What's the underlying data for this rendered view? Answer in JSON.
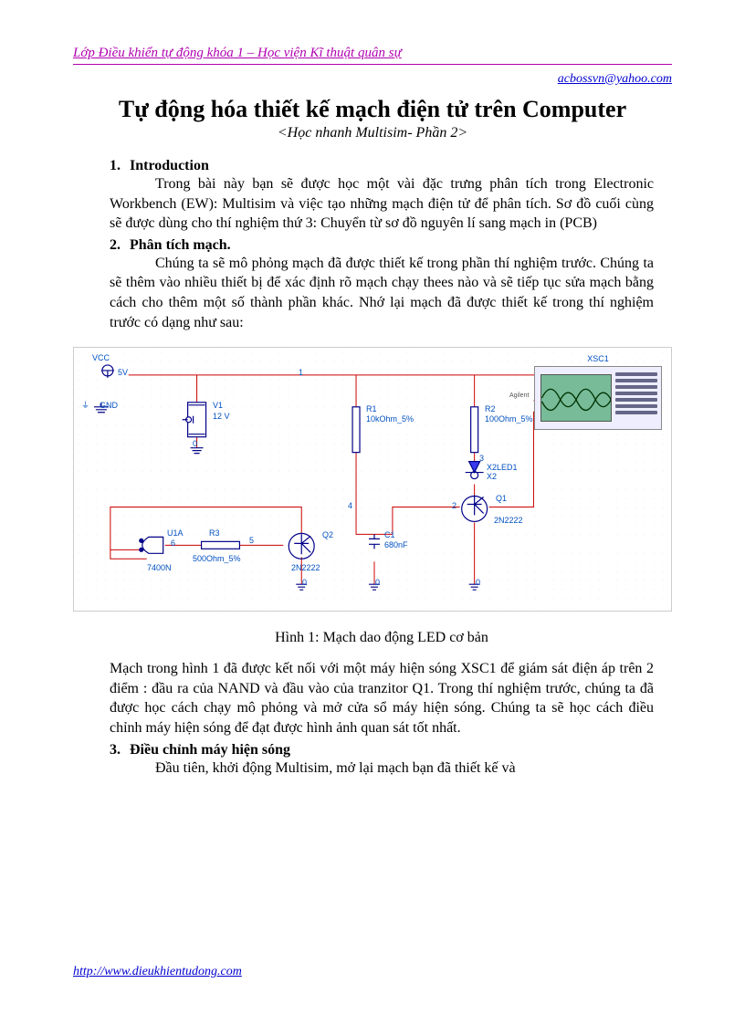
{
  "header": {
    "course": "Lớp Điều khiển tự động khóa 1 – Học viện Kĩ thuật quân sự",
    "email": "acbossvn@yahoo.com"
  },
  "title": "Tự động hóa thiết kế mạch điện tử trên Computer",
  "subtitle": "<Học nhanh Multisim- Phần 2>",
  "sections": {
    "s1": {
      "num": "1.",
      "head": "Introduction",
      "p1": "Trong bài này bạn sẽ được học một vài đặc trưng phân tích trong Electronic Workbench (EW): Multisim và việc tạo những mạch điện tử để phân tích. Sơ đồ cuối cùng sẽ được dùng cho thí nghiệm thứ 3: Chuyển từ sơ đồ nguyên lí sang mạch in (PCB)"
    },
    "s2": {
      "num": "2.",
      "head": "Phân tích mạch",
      "dot": ".",
      "p1": "Chúng ta sẽ mô phỏng mạch đã được thiết kế trong phần thí nghiệm trước. Chúng ta sẽ thêm vào nhiều thiết bị để xác định rõ mạch chạy thees nào và sẽ tiếp tục sửa mạch bằng cách cho thêm một số thành phần khác. Nhớ lại mạch đã được thiết kế trong thí nghiệm trước có dạng như sau:"
    },
    "caption": "Hình 1: Mạch dao động LED cơ bản",
    "p_after_fig": "Mạch trong hình 1 đã được kết nối với một máy hiện sóng XSC1 để giám sát điện áp trên 2 điểm : đầu ra của NAND và đầu vào của tranzitor Q1. Trong thí nghiệm trước, chúng ta đã được học cách chạy mô phỏng và  mở cửa sổ máy hiện sóng. Chúng ta sẽ học cách điều chỉnh máy hiện sóng để đạt được hình ảnh quan sát tốt nhất.",
    "s3": {
      "num": "3.",
      "head": "Điều chỉnh máy hiện sóng",
      "p1": "Đầu tiên, khởi động Multisim, mở lại mạch bạn đã thiết kế và"
    }
  },
  "circuit": {
    "vcc": "VCC",
    "v5": "5V",
    "gnd": "GND",
    "v1": "V1",
    "v12": "12 V",
    "r1": "R1",
    "r1v": "10kOhm_5%",
    "r2": "R2",
    "r2v": "100Ohm_5%",
    "xsc": "XSC1",
    "agilent": "Agilent",
    "led": "X2LED1",
    "ledx": "X2",
    "q1": "Q1",
    "q1t": "2N2222",
    "q2": "Q2",
    "q2t": "2N2222",
    "u1a": "U1A",
    "ic": "7400N",
    "r3": "R3",
    "r3v": "500Ohm_5%",
    "c1": "C1",
    "c1v": "680nF",
    "n0": "0",
    "n1": "1",
    "n2": "2",
    "n3": "3",
    "n4": "4",
    "n5": "5",
    "n6": "6"
  },
  "footer": "http://www.dieukhientudong.com"
}
